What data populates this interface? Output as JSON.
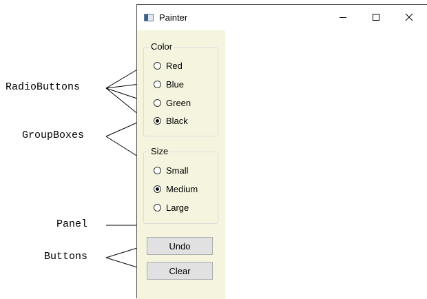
{
  "window": {
    "title": "Painter",
    "minimize_icon": "minimize-icon",
    "maximize_icon": "maximize-icon",
    "close_icon": "close-icon"
  },
  "color_group": {
    "title": "Color",
    "options": [
      {
        "label": "Red",
        "checked": false
      },
      {
        "label": "Blue",
        "checked": false
      },
      {
        "label": "Green",
        "checked": false
      },
      {
        "label": "Black",
        "checked": true
      }
    ]
  },
  "size_group": {
    "title": "Size",
    "options": [
      {
        "label": "Small",
        "checked": false
      },
      {
        "label": "Medium",
        "checked": true
      },
      {
        "label": "Large",
        "checked": false
      }
    ]
  },
  "buttons": {
    "undo": "Undo",
    "clear": "Clear"
  },
  "callouts": {
    "radio_buttons": "RadioButtons",
    "group_boxes": "GroupBoxes",
    "panel": "Panel",
    "buttons": "Buttons"
  },
  "colors": {
    "panel_background": "#f5f5df",
    "button_background": "#e1e1e1"
  }
}
